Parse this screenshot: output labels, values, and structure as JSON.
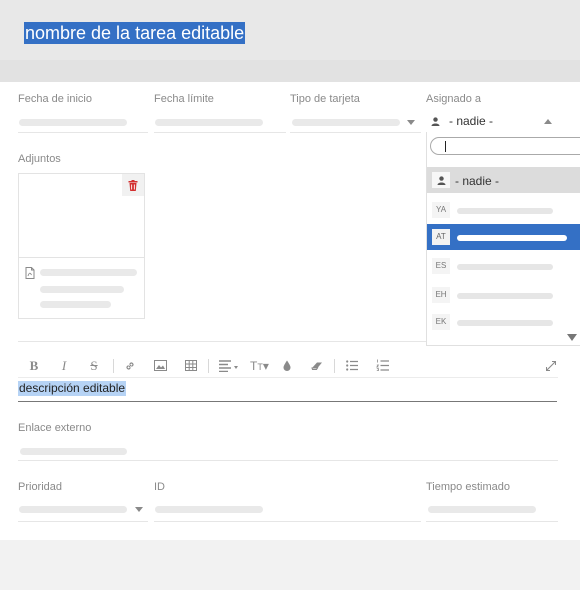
{
  "task": {
    "title": "nombre de la tarea editable"
  },
  "fields": {
    "start_date": {
      "label": "Fecha de inicio"
    },
    "due_date": {
      "label": "Fecha límite"
    },
    "card_type": {
      "label": "Tipo de tarjeta"
    },
    "assigned_to": {
      "label": "Asignado a",
      "value": "- nadie -"
    }
  },
  "attachments": {
    "label": "Adjuntos"
  },
  "editor": {
    "toolbar": [
      "bold-icon",
      "italic-icon",
      "strikethrough-icon",
      "link-icon",
      "image-icon",
      "table-icon",
      "align-icon",
      "text-size-icon",
      "color-icon",
      "eraser-icon",
      "bullet-list-icon",
      "numbered-list-icon",
      "expand-icon"
    ],
    "description": "descripción editable"
  },
  "external_link": {
    "label": "Enlace externo"
  },
  "priority": {
    "label": "Prioridad"
  },
  "id": {
    "label": "ID"
  },
  "estimated_time": {
    "label": "Tiempo estimado"
  },
  "assignee_dropdown": {
    "search_placeholder": "",
    "none_option": "- nadie -",
    "users": [
      {
        "initials": "YA",
        "selected": false
      },
      {
        "initials": "AT",
        "selected": true
      },
      {
        "initials": "ES",
        "selected": false
      },
      {
        "initials": "EH",
        "selected": false
      },
      {
        "initials": "EK",
        "selected": false
      }
    ]
  },
  "colors": {
    "accent": "#3470c5",
    "danger": "#d32f2f",
    "highlight": "#b6d3f5"
  }
}
